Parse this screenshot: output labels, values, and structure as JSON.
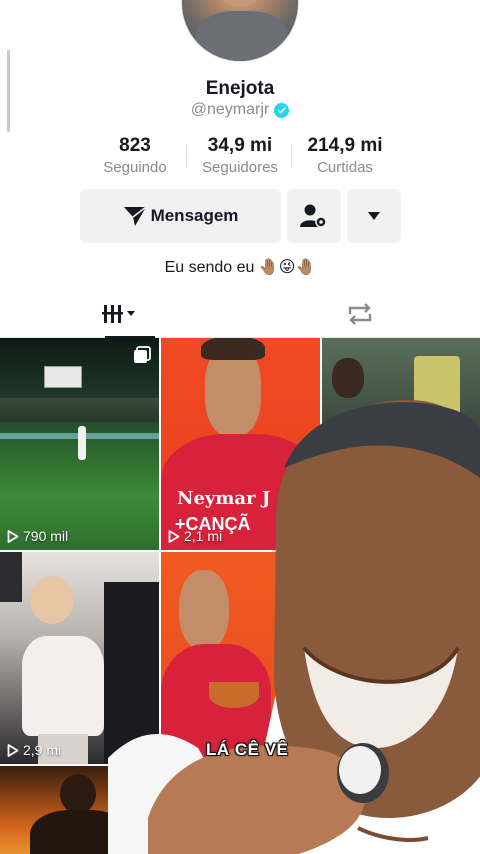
{
  "profile": {
    "name": "Enejota",
    "handle": "@neymarjr",
    "verified": true,
    "stats": [
      {
        "value": "823",
        "label": "Seguindo"
      },
      {
        "value": "34,9 mi",
        "label": "Seguidores"
      },
      {
        "value": "214,9 mi",
        "label": "Curtidas"
      }
    ],
    "bio": "Eu sendo eu 🤚🏽😜🤚🏽"
  },
  "actions": {
    "message_label": "Mensagem",
    "add_friend_icon": "person-gear-icon",
    "more_icon": "caret-down-icon"
  },
  "tabs": [
    {
      "icon": "video-grid-icon",
      "active": true
    },
    {
      "icon": "repost-icon",
      "active": false
    }
  ],
  "videos": [
    {
      "views": "790 mil",
      "pinned_icon": "multi-photo-icon"
    },
    {
      "views": "2,1 mi",
      "overlay_text": "Neymar J"
    },
    {
      "views": ""
    },
    {
      "views": "2,9 mi"
    },
    {
      "views": ""
    }
  ],
  "overlay": {
    "caption": "LÁ CÊ VÊ"
  },
  "colors": {
    "accent_verified": "#20d5ec",
    "text_primary": "#161823",
    "text_secondary": "#8a8b91",
    "button_bg": "#f1f1f2"
  }
}
